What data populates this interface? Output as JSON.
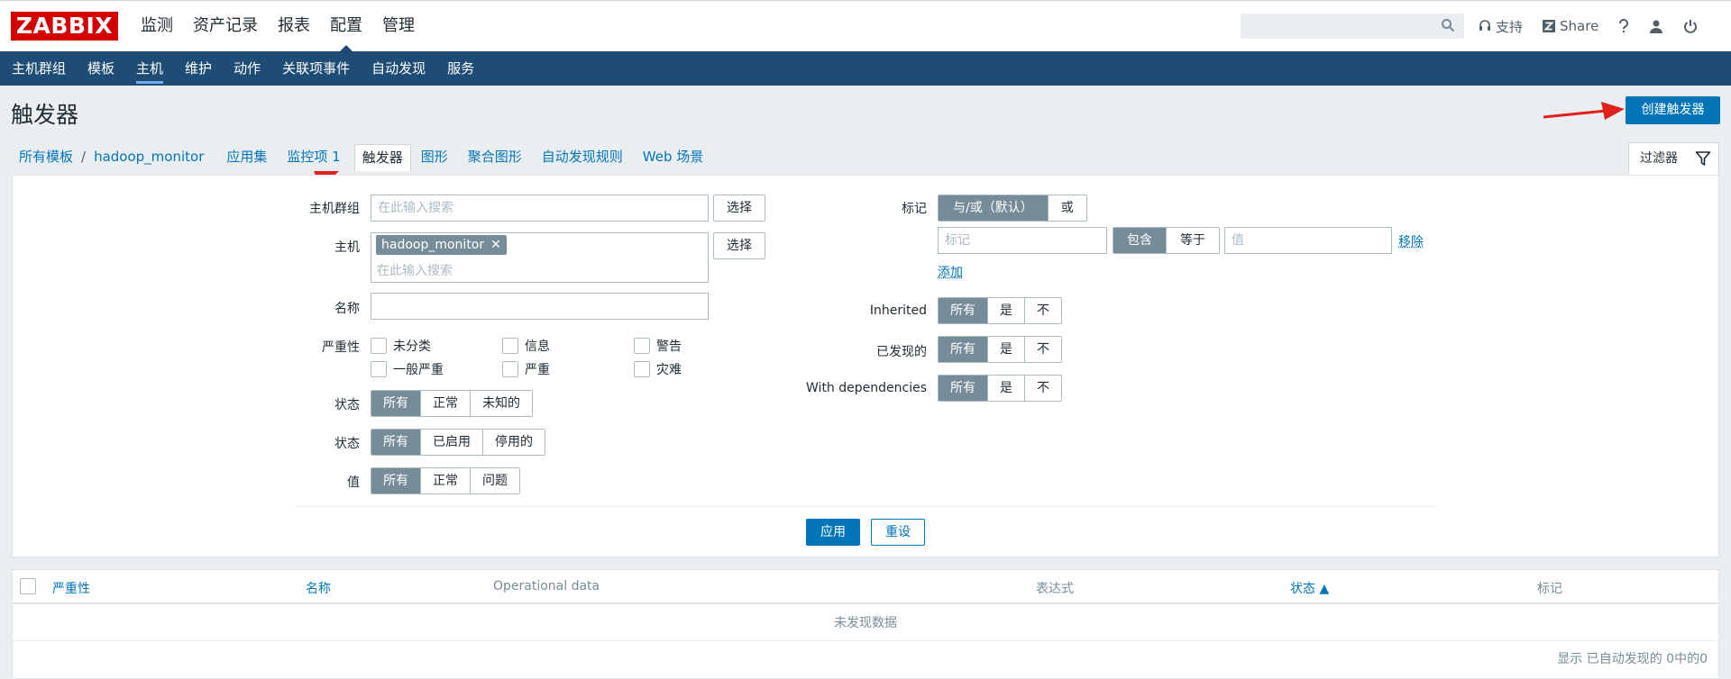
{
  "header": {
    "logo": "ZABBIX",
    "main_nav": [
      "监测",
      "资产记录",
      "报表",
      "配置",
      "管理"
    ],
    "active_main": "配置",
    "support_label": "支持",
    "share_label": "Share"
  },
  "subnav": {
    "items": [
      "主机群组",
      "模板",
      "主机",
      "维护",
      "动作",
      "关联项事件",
      "自动发现",
      "服务"
    ],
    "active": "主机"
  },
  "page": {
    "title": "触发器",
    "create_button": "创建触发器"
  },
  "tabs": {
    "items": [
      "所有模板",
      "hadoop_monitor",
      "应用集",
      "监控项 1",
      "触发器",
      "图形",
      "聚合图形",
      "自动发现规则",
      "Web 场景"
    ],
    "separator": "/",
    "active": "触发器",
    "filter_label": "过滤器"
  },
  "filter": {
    "host_group_label": "主机群组",
    "host_group_placeholder": "在此输入搜索",
    "select_label": "选择",
    "host_label": "主机",
    "host_chip": "hadoop_monitor",
    "host_placeholder": "在此输入搜索",
    "name_label": "名称",
    "severity_label": "严重性",
    "severities": [
      "未分类",
      "信息",
      "警告",
      "一般严重",
      "严重",
      "灾难"
    ],
    "state_label": "状态",
    "state_options": [
      "所有",
      "正常",
      "未知的"
    ],
    "status_label": "状态",
    "status_options": [
      "所有",
      "已启用",
      "停用的"
    ],
    "value_label": "值",
    "value_options": [
      "所有",
      "正常",
      "问题"
    ],
    "tags_label": "标记",
    "tags_mode": [
      "与/或（默认）",
      "或"
    ],
    "tag_placeholder": "标记",
    "tag_operators": [
      "包含",
      "等于"
    ],
    "value_placeholder": "值",
    "remove_label": "移除",
    "add_label": "添加",
    "inherited_label": "Inherited",
    "inherited_options": [
      "所有",
      "是",
      "不"
    ],
    "discovered_label": "已发现的",
    "discovered_options": [
      "所有",
      "是",
      "不"
    ],
    "deps_label": "With dependencies",
    "deps_options": [
      "所有",
      "是",
      "不"
    ],
    "apply_label": "应用",
    "reset_label": "重设"
  },
  "table": {
    "columns": [
      "严重性",
      "名称",
      "Operational data",
      "表达式",
      "状态 ▲",
      "标记"
    ],
    "no_data": "未发现数据",
    "footer": "显示 已自动发现的 0中的0"
  },
  "colors": {
    "brand": "#d40000",
    "nav_bg": "#1f4c75",
    "primary": "#0275b8",
    "arrow": "#e0201e",
    "seg_active": "#768d99"
  }
}
